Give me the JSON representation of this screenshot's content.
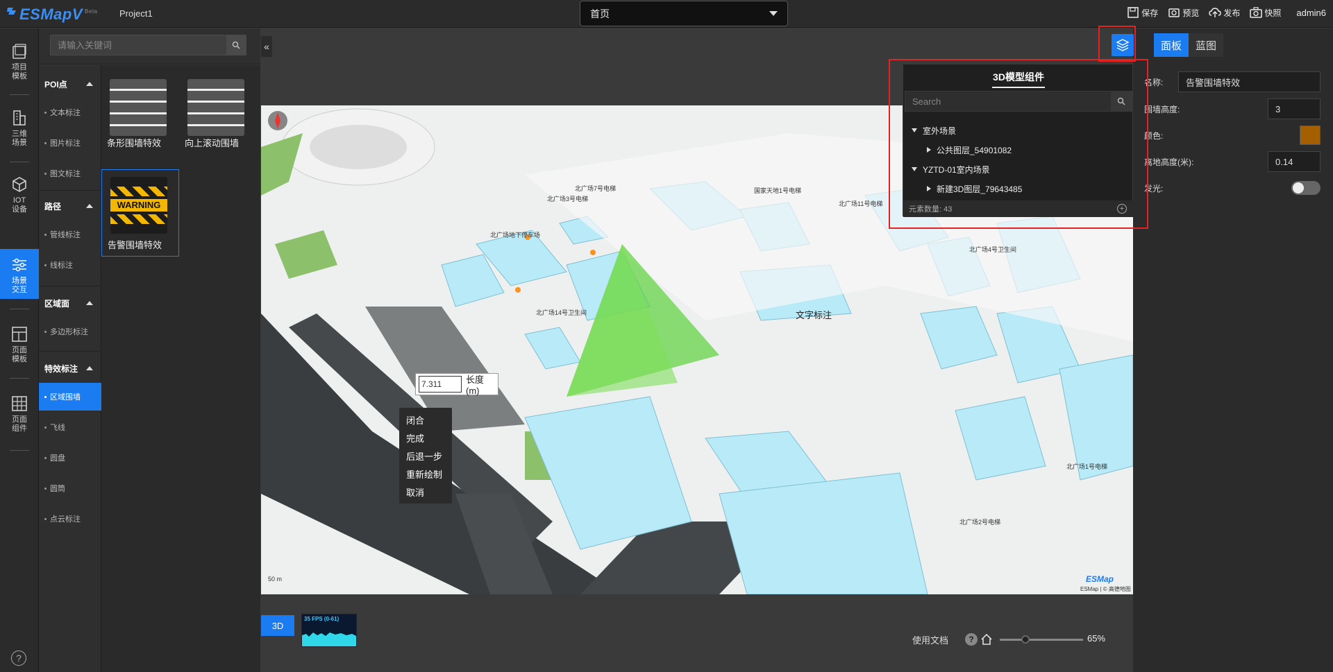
{
  "header": {
    "logo": "ESMapV",
    "logo_badge": "Beta",
    "project": "Project1",
    "page_select": "首页",
    "actions": [
      {
        "label": "保存",
        "icon": "save-icon"
      },
      {
        "label": "预览",
        "icon": "preview-icon"
      },
      {
        "label": "发布",
        "icon": "publish-icon"
      },
      {
        "label": "快照",
        "icon": "camera-icon"
      }
    ],
    "user": "admin6"
  },
  "left_nav": {
    "items": [
      {
        "label": "项目\n模板",
        "icon": "project-template-icon"
      },
      {
        "label": "三维\n场景",
        "icon": "building-icon"
      },
      {
        "label": "IOT\n设备",
        "icon": "cube-icon"
      },
      {
        "label": "场景\n交互",
        "icon": "sliders-icon",
        "active": true
      },
      {
        "label": "页面\n模板",
        "icon": "page-template-icon"
      },
      {
        "label": "页面\n组件",
        "icon": "grid-icon"
      }
    ],
    "help": "?"
  },
  "search": {
    "placeholder": "请输入关键词"
  },
  "categories": [
    {
      "title": "POI点",
      "items": [
        "文本标注",
        "图片标注",
        "图文标注"
      ]
    },
    {
      "title": "路径",
      "items": [
        "管线标注",
        "线标注"
      ]
    },
    {
      "title": "区域面",
      "items": [
        "多边形标注"
      ]
    },
    {
      "title": "特效标注",
      "items": [
        "区域围墙",
        "飞线",
        "圆盘",
        "圆筒",
        "点云标注"
      ],
      "active_item": "区域围墙"
    }
  ],
  "cards": [
    {
      "label": "条形围墙特效",
      "thumb": "stripes"
    },
    {
      "label": "向上滚动围墙",
      "thumb": "stripes"
    },
    {
      "label": "告警围墙特效",
      "thumb": "warning",
      "selected": true
    }
  ],
  "warning_text": "WARNING",
  "viewport": {
    "text_label": "文字标注",
    "length_value": "7.311",
    "length_unit": "长度(m)",
    "context_menu": [
      "闭合",
      "完成",
      "后退一步",
      "重新绘制",
      "取消"
    ],
    "map_labels": [
      "北广场地下停车场",
      "北广场14号卫生间",
      "北广场11号电梯",
      "国家天地1号电梯",
      "北广场7号电梯",
      "北广场3号电梯",
      "北广场4号卫生间",
      "北广场1号电梯",
      "北广场2号电梯"
    ],
    "scale": "50 m",
    "brand": "ESMap",
    "credit": "ESMap | © 高德地图"
  },
  "bottom": {
    "mode": "3D",
    "fps": "35 FPS (0-61)",
    "docs": "使用文档",
    "help": "?",
    "zoom": "65%",
    "zoom_level": 0.26
  },
  "right_panel": {
    "tabs": [
      "面板",
      "蓝图"
    ],
    "active_tab": "面板",
    "fields": [
      {
        "label": "名称:",
        "value": "告警围墙特效",
        "type": "text"
      },
      {
        "label": "围墙高度:",
        "value": "3",
        "type": "number"
      },
      {
        "label": "颜色:",
        "value": "#a35f00",
        "type": "color"
      },
      {
        "label": "离地高度(米):",
        "value": "0.14",
        "type": "number"
      },
      {
        "label": "发光:",
        "value": "off",
        "type": "toggle"
      }
    ]
  },
  "layer_panel": {
    "title": "3D模型组件",
    "search_placeholder": "Search",
    "tree": [
      {
        "label": "室外场景",
        "expanded": true,
        "children": [
          "公共图层_54901082"
        ]
      },
      {
        "label": "YZTD-01室内场景",
        "expanded": true,
        "children": [
          "新建3D图层_79643485"
        ]
      }
    ],
    "footer": "元素数量: 43",
    "add": "+"
  },
  "colors": {
    "accent": "#1a7cf0",
    "highlight": "#e52222",
    "panel": "#2b2b2b"
  }
}
